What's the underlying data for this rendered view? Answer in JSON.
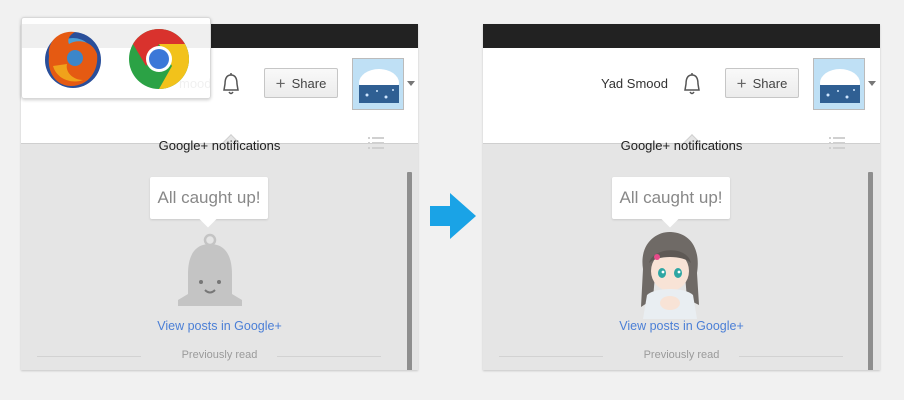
{
  "before": {
    "user_name_partial": "mood",
    "share_label": "Share",
    "notifications_title": "Google+ notifications",
    "caught_up": "All caught up!",
    "view_posts": "View posts in Google+",
    "previously_read": "Previously read",
    "browsers": [
      "firefox-logo-icon",
      "chrome-logo-icon"
    ]
  },
  "after": {
    "user_name": "Yad Smood",
    "share_label": "Share",
    "notifications_title": "Google+ notifications",
    "caught_up": "All caught up!",
    "view_posts": "View posts in Google+",
    "previously_read": "Previously read"
  },
  "colors": {
    "topbar": "#222222",
    "panel_bg": "#e5e5e5",
    "link": "#4b7fd6",
    "arrow": "#1aa3e6",
    "bell_gray": "#c4c4c4"
  }
}
